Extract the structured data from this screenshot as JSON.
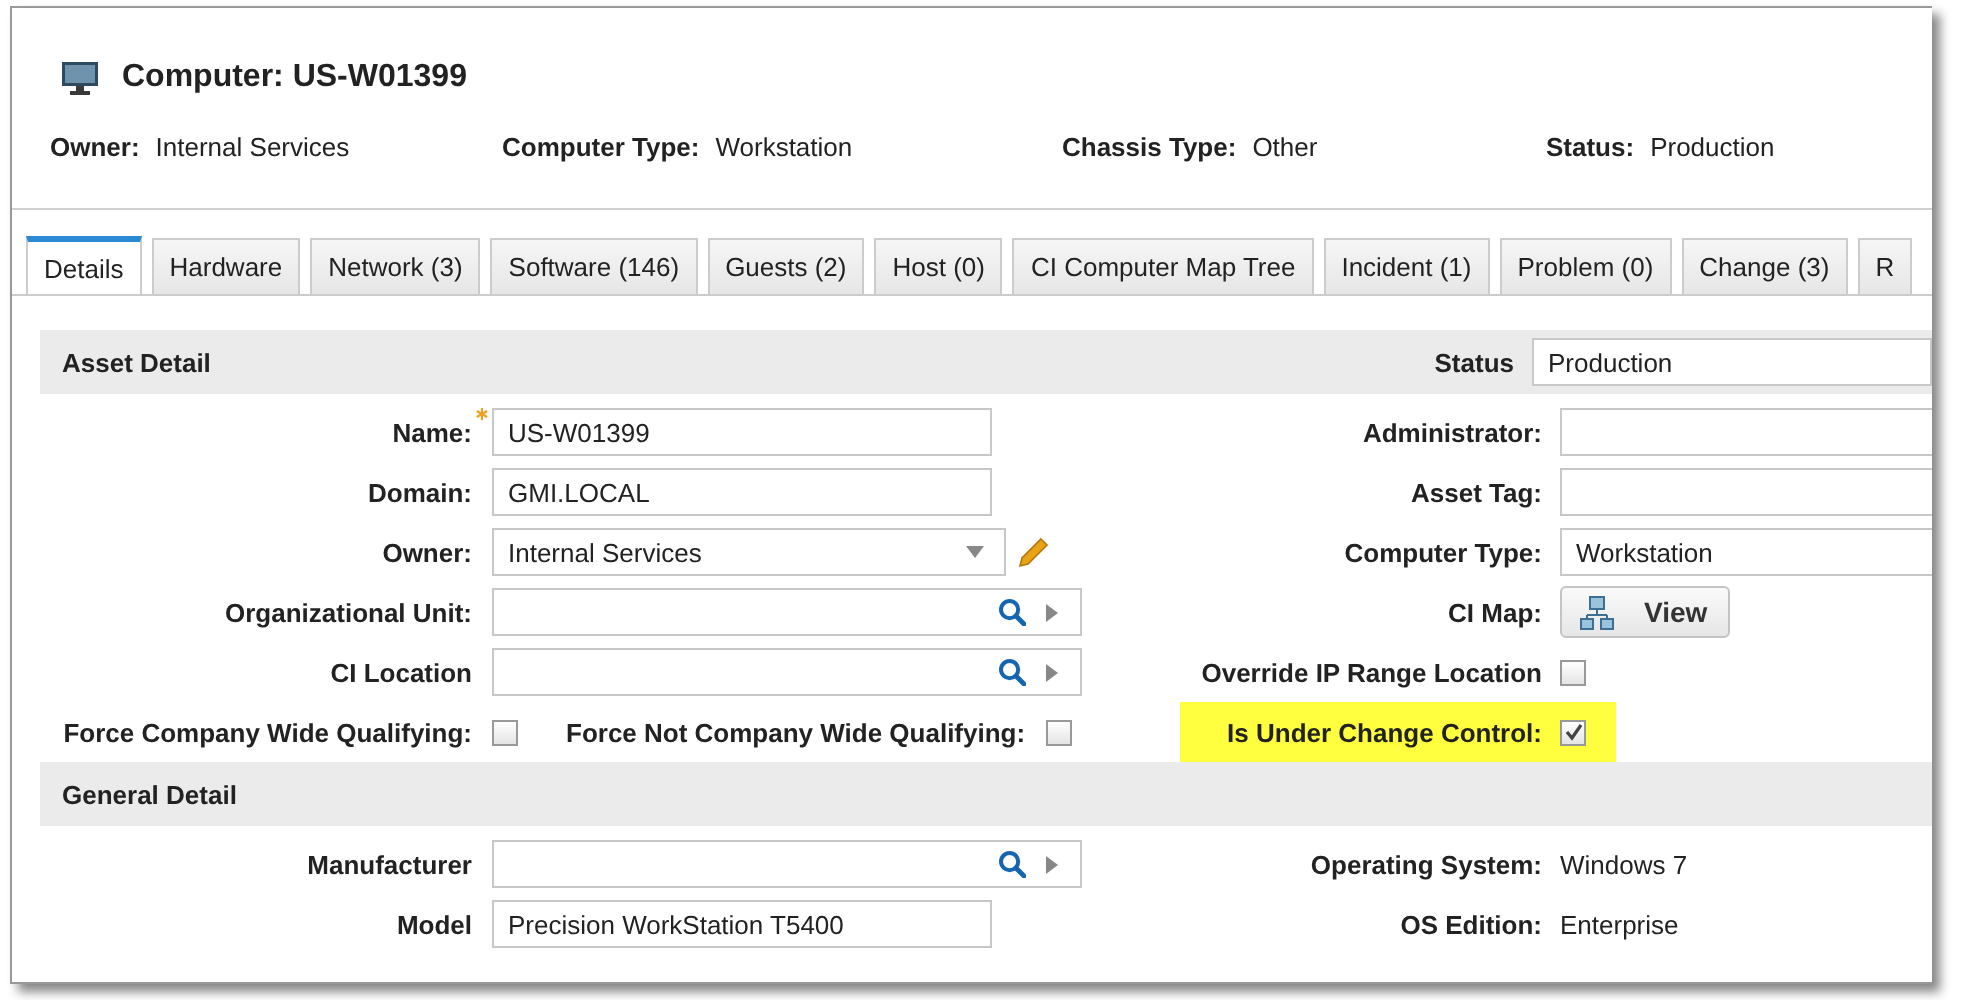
{
  "header": {
    "title": "Computer: US-W01399",
    "meta": [
      {
        "label": "Owner:",
        "value": "Internal Services"
      },
      {
        "label": "Computer Type:",
        "value": "Workstation"
      },
      {
        "label": "Chassis Type:",
        "value": "Other"
      },
      {
        "label": "Status:",
        "value": "Production"
      }
    ]
  },
  "tabs": [
    {
      "label": "Details",
      "selected": true
    },
    {
      "label": "Hardware",
      "selected": false
    },
    {
      "label": "Network (3)",
      "selected": false
    },
    {
      "label": "Software (146)",
      "selected": false
    },
    {
      "label": "Guests (2)",
      "selected": false
    },
    {
      "label": "Host (0)",
      "selected": false
    },
    {
      "label": "CI Computer Map Tree",
      "selected": false
    },
    {
      "label": "Incident (1)",
      "selected": false
    },
    {
      "label": "Problem (0)",
      "selected": false
    },
    {
      "label": "Change (3)",
      "selected": false
    },
    {
      "label": "R",
      "selected": false
    }
  ],
  "sections": [
    {
      "title": "Asset Detail",
      "header_field": {
        "label": "Status",
        "kind": "select",
        "value": "Production"
      },
      "rows": [
        {
          "left": [
            {
              "label": "Name:",
              "kind": "text",
              "value": "US-W01399",
              "required": true
            }
          ],
          "right": [
            {
              "label": "Administrator:",
              "kind": "select"
            }
          ]
        },
        {
          "left": [
            {
              "label": "Domain:",
              "kind": "text",
              "value": "GMI.LOCAL"
            }
          ],
          "right": [
            {
              "label": "Asset Tag:",
              "kind": "text"
            }
          ]
        },
        {
          "left": [
            {
              "label": "Owner:",
              "kind": "select_edit",
              "value": "Internal Services"
            }
          ],
          "right": [
            {
              "label": "Computer Type:",
              "kind": "select",
              "value": "Workstation"
            }
          ]
        },
        {
          "left": [
            {
              "label": "Organizational Unit:",
              "kind": "lookup"
            }
          ],
          "right": [
            {
              "label": "CI Map:",
              "kind": "button",
              "value": "View"
            }
          ]
        },
        {
          "left": [
            {
              "label": "CI Location",
              "kind": "lookup"
            }
          ],
          "right": [
            {
              "label": "Override IP Range Location",
              "kind": "checkbox",
              "checked": false
            }
          ]
        },
        {
          "left": [
            {
              "label": "Force Company Wide Qualifying:",
              "kind": "checkbox",
              "checked": false
            },
            {
              "label": "Force Not Company Wide Qualifying:",
              "kind": "checkbox",
              "checked": false
            }
          ],
          "right": [
            {
              "label": "Is Under Change Control:",
              "kind": "checkbox",
              "checked": true,
              "highlighted": true
            }
          ]
        }
      ]
    },
    {
      "title": "General Detail",
      "rows": [
        {
          "left": [
            {
              "label": "Manufacturer",
              "kind": "lookup"
            }
          ],
          "right": [
            {
              "label": "Operating System:",
              "kind": "readonly",
              "value": "Windows 7"
            }
          ]
        },
        {
          "left": [
            {
              "label": "Model",
              "kind": "text",
              "value": "Precision WorkStation T5400"
            }
          ],
          "right": [
            {
              "label": "OS Edition:",
              "kind": "readonly",
              "value": "Enterprise"
            }
          ]
        }
      ]
    }
  ]
}
